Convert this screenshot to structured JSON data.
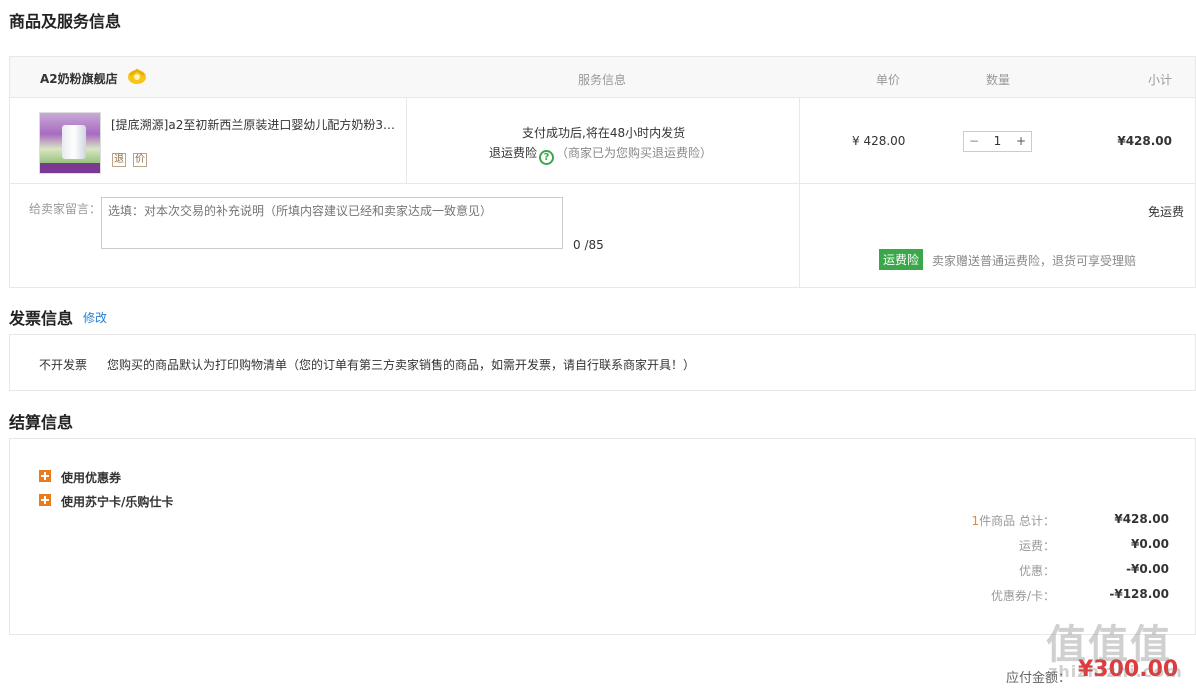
{
  "goods_section": {
    "title": "商品及服务信息",
    "header": {
      "store": "A2奶粉旗舰店",
      "col_service": "服务信息",
      "col_price": "单价",
      "col_qty": "数量",
      "col_subtotal": "小计"
    },
    "item": {
      "name": "[提底溯源]a2至初新西兰原装进口婴幼儿配方奶粉3…",
      "tag_return": "退",
      "tag_price": "价",
      "service_line1": "支付成功后,将在48小时内发货",
      "service_insurance": "退运费险",
      "service_insurance_note": "（商家已为您购买退运费险）",
      "price": "¥ 428.00",
      "qty_minus": "−",
      "qty": "1",
      "qty_plus": "+",
      "subtotal": "¥428.00"
    },
    "message": {
      "label": "给卖家留言：",
      "placeholder": "选填：对本次交易的补充说明（所填内容建议已经和卖家达成一致意见）",
      "count": "0 /85",
      "shipping": "免运费",
      "insurance_badge": "运费险",
      "insurance_text": "卖家赠送普通运费险，退货可享受理赔"
    }
  },
  "invoice_section": {
    "title": "发票信息",
    "edit": "修改",
    "type": "不开发票",
    "desc": "您购买的商品默认为打印购物清单（您的订单有第三方卖家销售的商品，如需开发票，请自行联系商家开具！）"
  },
  "settle_section": {
    "title": "结算信息",
    "option_coupon": "使用优惠券",
    "option_card": "使用苏宁卡/乐购仕卡",
    "summary": {
      "count_prefix": "1",
      "total_label": "件商品 总计：",
      "total": "¥428.00",
      "shipping_label": "运费：",
      "shipping": "¥0.00",
      "discount_label": "优惠：",
      "discount": "-¥0.00",
      "coupon_label": "优惠券/卡：",
      "coupon": "-¥128.00"
    },
    "payable_label": "应付金额：",
    "payable": "¥300.00"
  },
  "watermark": {
    "main": "值值值",
    "sub": "zhizhizhi.com"
  }
}
